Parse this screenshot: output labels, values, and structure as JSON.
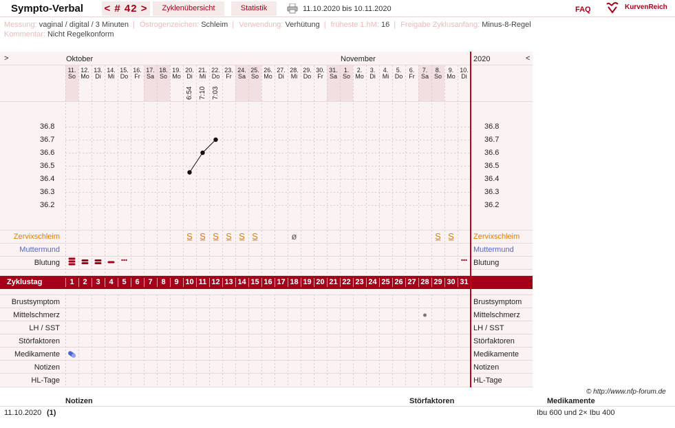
{
  "header": {
    "app_title": "Sympto-Verbal",
    "cycle_nav": "< # 42 >",
    "tab_overview": "Zyklenübersicht",
    "tab_stats": "Statistik",
    "date_range": "11.10.2020 bis 10.11.2020",
    "faq": "FAQ",
    "logo": "KurvenReich",
    "icons": [
      "printer-icon",
      "kurvenreich-logo-icon"
    ]
  },
  "info": {
    "messung_label": "Messung:",
    "messung_value": "vaginal / digital / 3 Minuten",
    "oestrogen_label": "Östrogenzeichen:",
    "oestrogen_value": "Schleim",
    "verwendung_label": "Verwendung:",
    "verwendung_value": "Verhütung",
    "hm_label": "früheste 1.hM:",
    "hm_value": "16",
    "freigabe_label": "Freigabe Zyklusanfang:",
    "freigabe_value": "Minus-8-Regel",
    "kommentar_label": "Kommentar:",
    "kommentar_value": "Nicht Regelkonform"
  },
  "chart": {
    "nav_left": ">",
    "nav_right": "<",
    "year": "2020",
    "month1": "Oktober",
    "month2": "November",
    "days": [
      {
        "d": "11.",
        "w": "So",
        "we": true
      },
      {
        "d": "12.",
        "w": "Mo",
        "we": false
      },
      {
        "d": "13.",
        "w": "Di",
        "we": false
      },
      {
        "d": "14.",
        "w": "Mi",
        "we": false
      },
      {
        "d": "15.",
        "w": "Do",
        "we": false
      },
      {
        "d": "16.",
        "w": "Fr",
        "we": false
      },
      {
        "d": "17.",
        "w": "Sa",
        "we": true
      },
      {
        "d": "18.",
        "w": "So",
        "we": true
      },
      {
        "d": "19.",
        "w": "Mo",
        "we": false
      },
      {
        "d": "20.",
        "w": "Di",
        "we": false
      },
      {
        "d": "21.",
        "w": "Mi",
        "we": false
      },
      {
        "d": "22.",
        "w": "Do",
        "we": false
      },
      {
        "d": "23.",
        "w": "Fr",
        "we": false
      },
      {
        "d": "24.",
        "w": "Sa",
        "we": true
      },
      {
        "d": "25.",
        "w": "So",
        "we": true
      },
      {
        "d": "26.",
        "w": "Mo",
        "we": false
      },
      {
        "d": "27.",
        "w": "Di",
        "we": false
      },
      {
        "d": "28.",
        "w": "Mi",
        "we": false
      },
      {
        "d": "29.",
        "w": "Do",
        "we": false
      },
      {
        "d": "30.",
        "w": "Fr",
        "we": false
      },
      {
        "d": "31.",
        "w": "Sa",
        "we": true
      },
      {
        "d": "1.",
        "w": "So",
        "we": true
      },
      {
        "d": "2.",
        "w": "Mo",
        "we": false
      },
      {
        "d": "3.",
        "w": "Di",
        "we": false
      },
      {
        "d": "4.",
        "w": "Mi",
        "we": false
      },
      {
        "d": "5.",
        "w": "Do",
        "we": false
      },
      {
        "d": "6.",
        "w": "Fr",
        "we": false
      },
      {
        "d": "7.",
        "w": "Sa",
        "we": true
      },
      {
        "d": "8.",
        "w": "So",
        "we": true
      },
      {
        "d": "9.",
        "w": "Mo",
        "we": false
      },
      {
        "d": "10.",
        "w": "Di",
        "we": false
      }
    ],
    "times": [
      {
        "col": 10,
        "t": "6:54"
      },
      {
        "col": 11,
        "t": "7:10"
      },
      {
        "col": 12,
        "t": "7:03"
      }
    ],
    "temp_ticks": [
      "36.8",
      "36.7",
      "36.6",
      "36.5",
      "36.4",
      "36.3",
      "36.2"
    ],
    "temperatures": [
      {
        "col": 10,
        "value": 36.45
      },
      {
        "col": 11,
        "value": 36.6
      },
      {
        "col": 12,
        "value": 36.7
      }
    ],
    "rows_top": [
      "Zervixschleim",
      "Muttermund",
      "Blutung"
    ],
    "zervix_marks": [
      {
        "col": 10,
        "sym": "S̲"
      },
      {
        "col": 11,
        "sym": "S̲"
      },
      {
        "col": 12,
        "sym": "S̲"
      },
      {
        "col": 13,
        "sym": "S̲"
      },
      {
        "col": 14,
        "sym": "S̲"
      },
      {
        "col": 15,
        "sym": "S̲"
      },
      {
        "col": 18,
        "sym": "ø"
      },
      {
        "col": 29,
        "sym": "S̲"
      },
      {
        "col": 30,
        "sym": "S̲"
      }
    ],
    "bleeding": [
      {
        "col": 1,
        "level": 4
      },
      {
        "col": 2,
        "level": 3
      },
      {
        "col": 3,
        "level": 3
      },
      {
        "col": 4,
        "level": 2
      },
      {
        "col": 5,
        "level": 1
      },
      {
        "col": 31,
        "level": 1
      }
    ],
    "zyklustag_label": "Zyklustag",
    "rows_bottom": [
      "Brustsymptom",
      "Mittelschmerz",
      "LH / SST",
      "Störfaktoren",
      "Medikamente",
      "Notizen",
      "HL-Tage"
    ],
    "mittelschmerz_col": 28,
    "medikament_col": 1
  },
  "copyright": "© http://www.nfp-forum.de",
  "bottom": {
    "notizen_head": "Notizen",
    "stoerfaktoren_head": "Störfaktoren",
    "medikamente_head": "Medikamente",
    "date": "11.10.2020",
    "notiz_ref": "(1)",
    "medikament_text": "Ibu 600 und 2× Ibu 400"
  },
  "colors": {
    "accent": "#a5001a",
    "zervix": "#e07b00",
    "muttermund": "#5566cc",
    "weekend": "#f2dfe2",
    "grid": "#d8c8c8"
  }
}
